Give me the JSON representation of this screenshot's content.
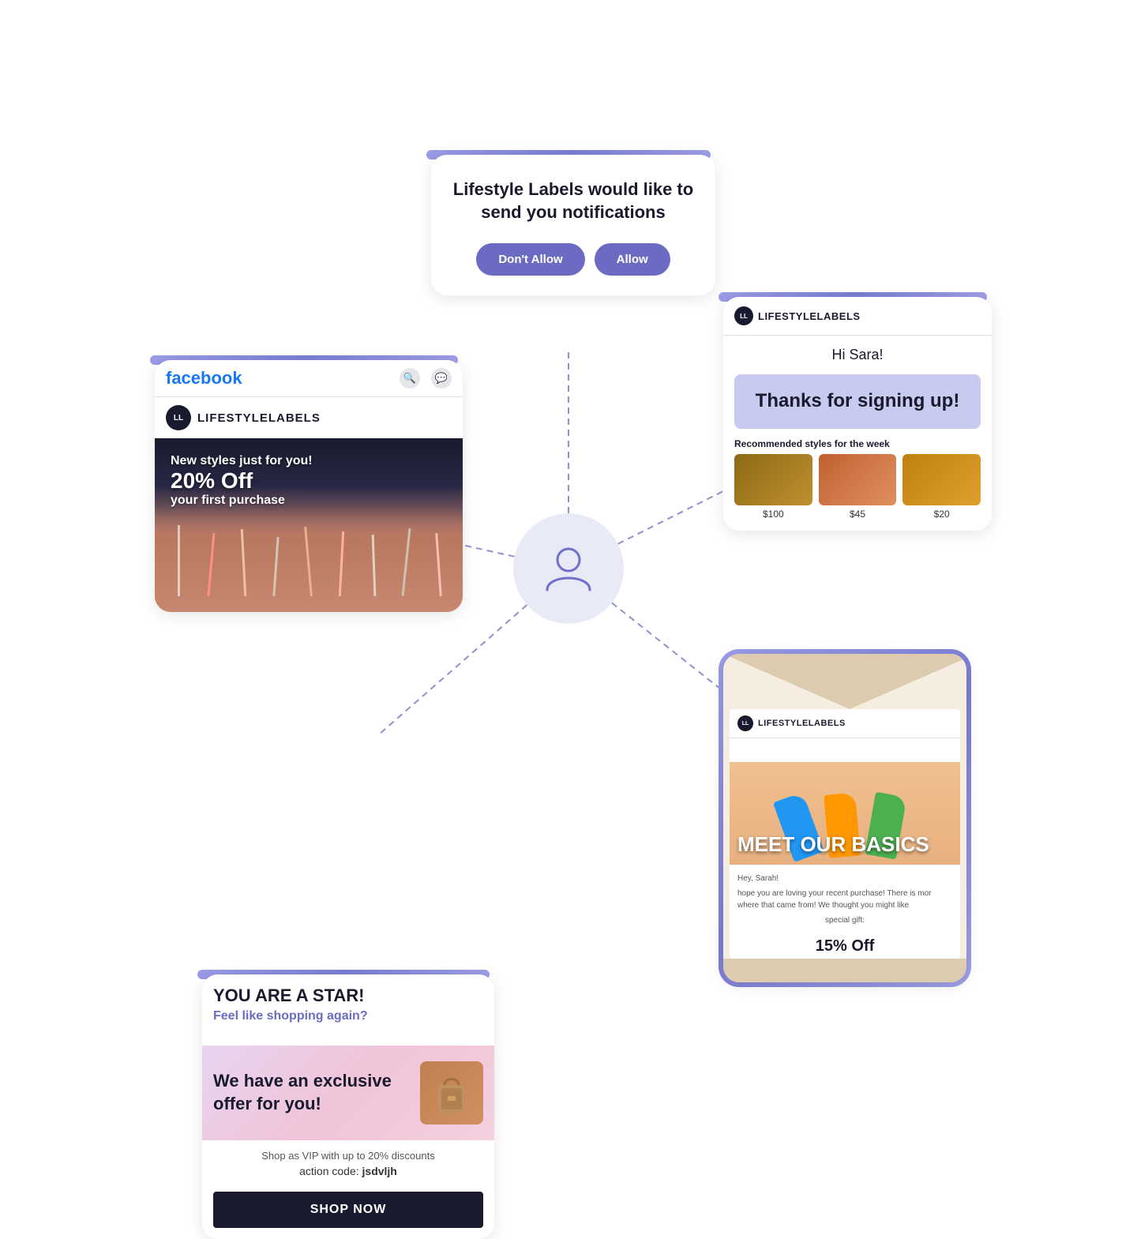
{
  "notification": {
    "title": "Lifestyle Labels would like to send you notifications",
    "dont_allow": "Don't Allow",
    "allow": "Allow"
  },
  "facebook_ad": {
    "logo": "LL",
    "brand": "LIFESTYLELABELS",
    "new_styles": "New styles just for you!",
    "discount": "20% Off",
    "first_purchase": "your first purchase",
    "logo_text": "facebook"
  },
  "email_signup": {
    "logo": "LL",
    "brand": "LIFESTYLELABELS",
    "greeting": "Hi Sara!",
    "thanks": "Thanks for signing up!",
    "recommended": "Recommended styles for the week",
    "product1_price": "$100",
    "product2_price": "$45",
    "product3_price": "$20"
  },
  "sms": {
    "you_are_star": "YOU ARE A STAR!",
    "feel_shopping": "Feel like shopping again?",
    "offer_text": "We have an exclusive offer for you!",
    "vip_text": "Shop as VIP with up to 20% discounts",
    "code_label": "action code:",
    "code": "jsdvljh",
    "shop_now": "SHOP NOW"
  },
  "direct_mail": {
    "logo": "LL",
    "brand": "LIFESTYLELABELS",
    "hero_text": "MEET OUR BASICS",
    "greeting": "Hey, Sarah!",
    "body_text": "hope you are loving your recent purchase! There is mor where that came from! We thought you might like",
    "special_gift": "special gift:",
    "discount": "15% Off"
  },
  "colors": {
    "purple_border": "#8080d0",
    "facebook_blue": "#1877f2",
    "brand_dark": "#1a1a2e",
    "accent_purple": "#6b6bc4"
  }
}
